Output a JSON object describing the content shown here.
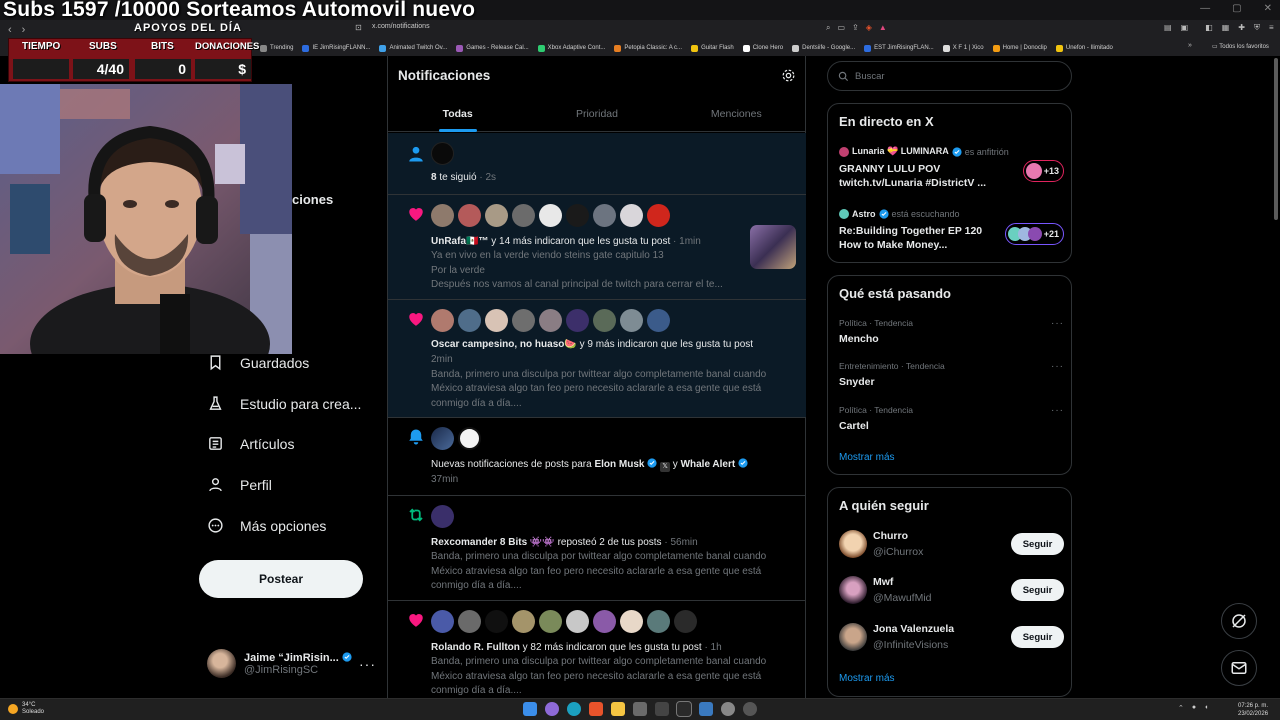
{
  "stream_overlay": {
    "title": "Subs 1597 /10000 Sorteamos Automovil nuevo",
    "subtitle": "APOYOS DEL DÍA",
    "stats": [
      {
        "label": "TIEMPO",
        "value": ""
      },
      {
        "label": "SUBS",
        "value": "4/40"
      },
      {
        "label": "BITS",
        "value": "0"
      },
      {
        "label": "DONACIONES",
        "value": "$"
      }
    ]
  },
  "browser": {
    "url": "x.com/notifications",
    "bookmarks": [
      {
        "label": "Trending",
        "color": "#888888"
      },
      {
        "label": "IE JimRisingFLANN...",
        "color": "#2d6cdf"
      },
      {
        "label": "Animated Twitch Ov...",
        "color": "#3fa0e8"
      },
      {
        "label": "Games - Release Cal...",
        "color": "#9b59b6"
      },
      {
        "label": "Xbox Adaptive Cont...",
        "color": "#2ecc71"
      },
      {
        "label": "Petopia Classic: A c...",
        "color": "#e67e22"
      },
      {
        "label": "Guitar Flash",
        "color": "#f1c40f"
      },
      {
        "label": "Clone Hero",
        "color": "#ffffff"
      },
      {
        "label": "Dentsiife - Google...",
        "color": "#cccccc"
      },
      {
        "label": "EST JimRisingFLAN...",
        "color": "#2d6cdf"
      },
      {
        "label": "X F 1 | Xico",
        "color": "#dddddd"
      },
      {
        "label": "Home | Donoclip",
        "color": "#f39c12"
      },
      {
        "label": "Unefon - Ilimitado",
        "color": "#f1c40f"
      }
    ],
    "bookmarks_more": "»",
    "all_bookmarks": "Todos los favoritos"
  },
  "left_nav": {
    "partial_label": "ciones",
    "partial_label2": "n",
    "items": [
      {
        "label": "Guardados",
        "icon": "bookmark-icon"
      },
      {
        "label": "Estudio para crea...",
        "icon": "flask-icon"
      },
      {
        "label": "Artículos",
        "icon": "article-icon"
      },
      {
        "label": "Perfil",
        "icon": "profile-icon"
      },
      {
        "label": "Más opciones",
        "icon": "more-options-icon"
      }
    ],
    "post_button": "Postear",
    "account": {
      "name": "Jaime “JimRisin...",
      "handle": "@JimRisingSC",
      "more": "···"
    }
  },
  "main": {
    "title": "Notificaciones",
    "tabs": [
      "Todas",
      "Prioridad",
      "Menciones"
    ],
    "notifications": [
      {
        "type": "follow",
        "text_count": "8",
        "text": " te siguió",
        "time": "· 2s"
      },
      {
        "type": "like",
        "name": "UnRafa🇲🇽™",
        "text": " y 14 más indicaron que les gusta tu post",
        "time": "· 1min",
        "preview": [
          "Ya en vivo en la verde viendo steins gate capitulo 13",
          "Por la verde",
          "Después nos vamos al canal principal de twitch para cerrar el te..."
        ]
      },
      {
        "type": "like",
        "name": "Oscar campesino, no huaso🍉",
        "text": " y 9 más indicaron que les gusta tu post",
        "time": "2min",
        "preview": [
          "Banda, primero una disculpa por twittear algo completamente banal cuando",
          "México atraviesa algo tan feo pero necesito aclararle a esa gente que está",
          "conmigo día a día...."
        ]
      },
      {
        "type": "bell",
        "text_a": "Nuevas notificaciones de posts para ",
        "name_a": "Elon Musk",
        "text_b": " y ",
        "name_b": "Whale Alert",
        "time": "37min"
      },
      {
        "type": "repost",
        "name": "Rexcomander 8 Bits 👾👾",
        "text": " reposteó 2 de tus posts",
        "time": "· 56min",
        "preview": [
          "Banda, primero una disculpa por twittear algo completamente banal cuando",
          "México atraviesa algo tan feo pero necesito aclararle a esa gente que está",
          "conmigo día a día...."
        ]
      },
      {
        "type": "like",
        "name": "Rolando R. Fullton",
        "text": " y 82 más indicaron que les gusta tu post",
        "time": "· 1h",
        "preview": [
          "Banda, primero una disculpa por twittear algo completamente banal cuando",
          "México atraviesa algo tan feo pero necesito aclararle a esa gente que está",
          "conmigo día a día...."
        ]
      }
    ]
  },
  "right": {
    "search_placeholder": "Buscar",
    "live": {
      "title": "En directo en X",
      "items": [
        {
          "host": "Lunaria 💝 LUMINARA",
          "role": "es anfitrión",
          "title": "GRANNY LULU POV twitch.tv/Lunaria #DistrictV ...",
          "badge": "+13",
          "color": "#e0245e"
        },
        {
          "host": "Astro",
          "role": "está escuchando",
          "title": "Re:Building Together EP 120 How to Make Money...",
          "badge": "+21",
          "color": "#7856ff"
        }
      ]
    },
    "trends": {
      "title": "Qué está pasando",
      "items": [
        {
          "category": "Política · Tendencia",
          "name": "Mencho"
        },
        {
          "category": "Entretenimiento · Tendencia",
          "name": "Snyder"
        },
        {
          "category": "Política · Tendencia",
          "name": "Cartel"
        }
      ],
      "more": "···",
      "show_more": "Mostrar más"
    },
    "follow": {
      "title": "A quién seguir",
      "items": [
        {
          "name": "Churro",
          "handle": "@iChurrox",
          "button": "Seguir"
        },
        {
          "name": "Mwf",
          "handle": "@MawufMid",
          "button": "Seguir"
        },
        {
          "name": "Jona Valenzuela",
          "handle": "@InfiniteVisions",
          "button": "Seguir"
        }
      ],
      "show_more": "Mostrar más"
    }
  },
  "taskbar": {
    "weather_temp": "34°C",
    "weather_desc": "Soleado",
    "time": "07:26 p. m.",
    "date": "23/02/2026"
  }
}
